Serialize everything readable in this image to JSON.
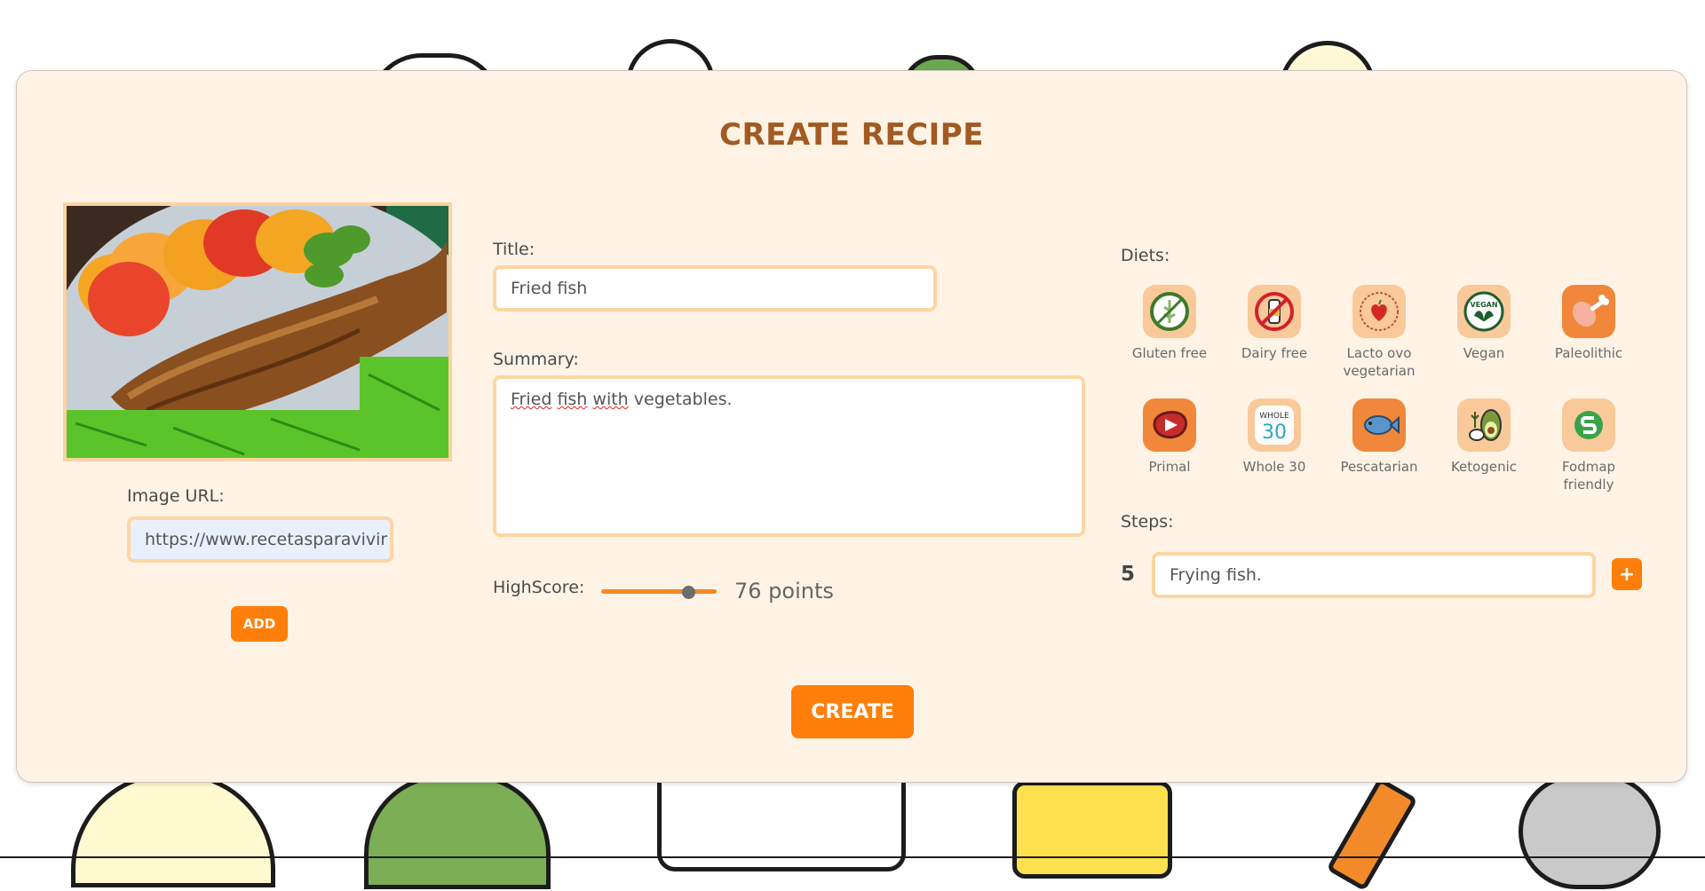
{
  "page": {
    "title": "CREATE RECIPE"
  },
  "image": {
    "label": "Image URL:",
    "url_value": "https://www.recetasparavivir",
    "add_label": "ADD"
  },
  "form": {
    "title_label": "Title:",
    "title_value": "Fried fish",
    "summary_label": "Summary:",
    "summary_words": [
      "Fried",
      "fish",
      "with",
      "vegetables."
    ],
    "highscore_label": "HighScore:",
    "highscore_value": 76,
    "highscore_text": "76 points",
    "highscore_max": 100
  },
  "diets": {
    "label": "Diets:",
    "items": [
      {
        "label": "Gluten free",
        "icon": "gluten-free-icon"
      },
      {
        "label": "Dairy free",
        "icon": "dairy-free-icon"
      },
      {
        "label": "Lacto ovo vegetarian",
        "icon": "lacto-ovo-icon"
      },
      {
        "label": "Vegan",
        "icon": "vegan-icon"
      },
      {
        "label": "Paleolithic",
        "icon": "paleolithic-icon"
      },
      {
        "label": "Primal",
        "icon": "primal-icon"
      },
      {
        "label": "Whole 30",
        "icon": "whole30-icon"
      },
      {
        "label": "Pescatarian",
        "icon": "pescatarian-icon"
      },
      {
        "label": "Ketogenic",
        "icon": "ketogenic-icon"
      },
      {
        "label": "Fodmap friendly",
        "icon": "fodmap-icon"
      }
    ]
  },
  "steps": {
    "label": "Steps:",
    "number": "5",
    "value": "Frying fish.",
    "add_label": "+"
  },
  "create_label": "CREATE",
  "colors": {
    "accent": "#ff7f0a",
    "title": "#a25a22",
    "card": "#fff3e6",
    "border": "#fcd6a3"
  }
}
